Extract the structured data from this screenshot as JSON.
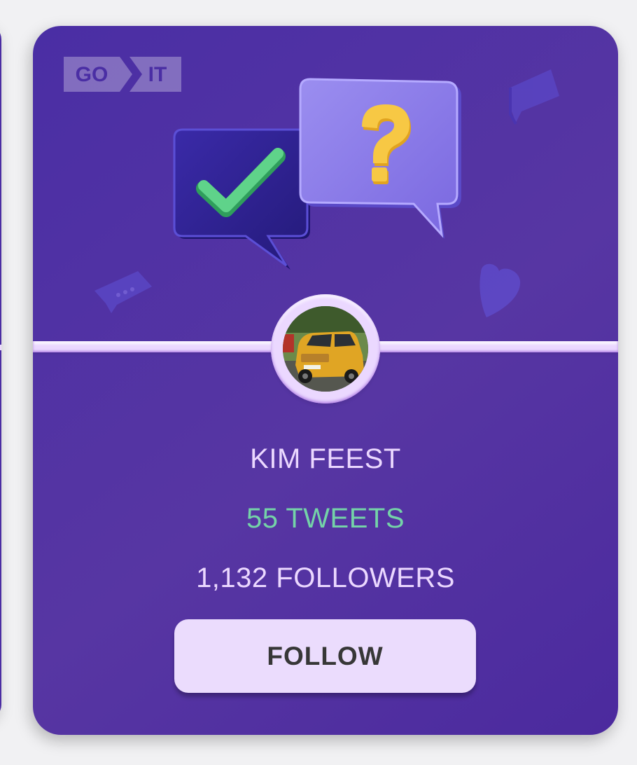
{
  "logo": {
    "left_text": "GO",
    "right_text": "IT"
  },
  "user": {
    "name": "KIM FEEST",
    "tweets": "55 TWEETS",
    "followers": "1,132 FOLLOWERS",
    "avatar_alt": "yellow car avatar"
  },
  "actions": {
    "follow_label": "FOLLOW"
  },
  "colors": {
    "card_bg": "#5736a3",
    "accent_light": "#ebd8ff",
    "tweets_green": "#74d3a8",
    "button_text": "#373737"
  },
  "icons": [
    "checkmark-bubble-icon",
    "question-bubble-icon",
    "chat-bubble-icon",
    "heart-icon"
  ]
}
